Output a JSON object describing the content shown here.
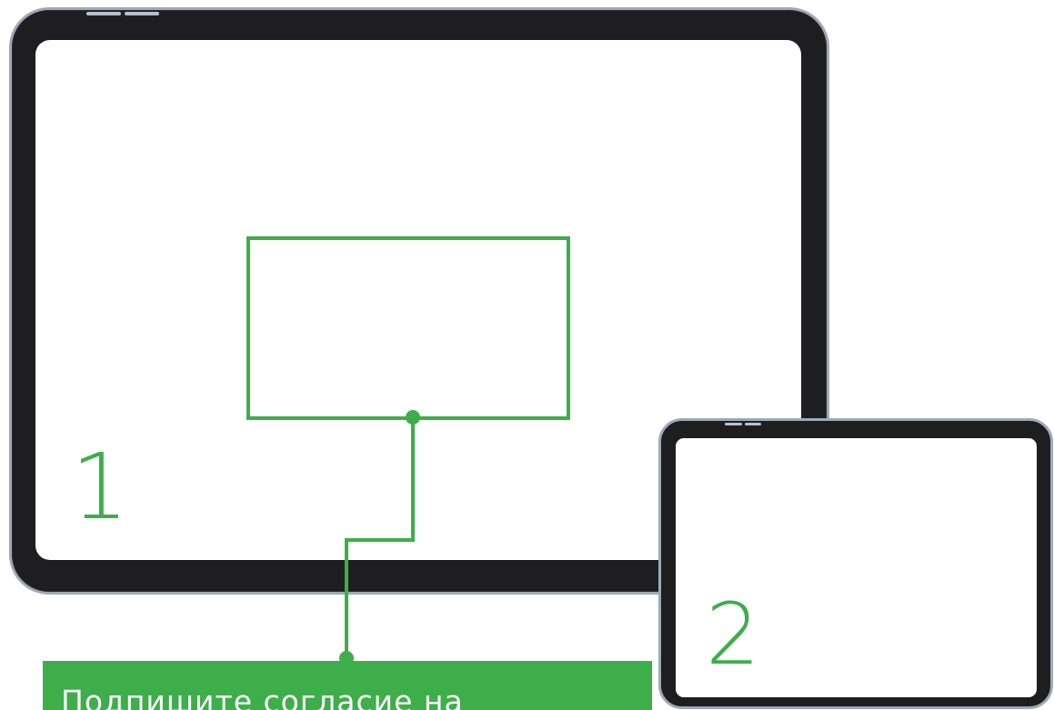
{
  "tablets": [
    {
      "number": "1"
    },
    {
      "number": "2"
    }
  ],
  "caption": {
    "text": "Подпишите согласие на"
  },
  "colors": {
    "accent_green": "#3dae49",
    "device_frame": "#1e1e20",
    "device_edge": "#9fa9b7",
    "screen": "#ffffff"
  }
}
